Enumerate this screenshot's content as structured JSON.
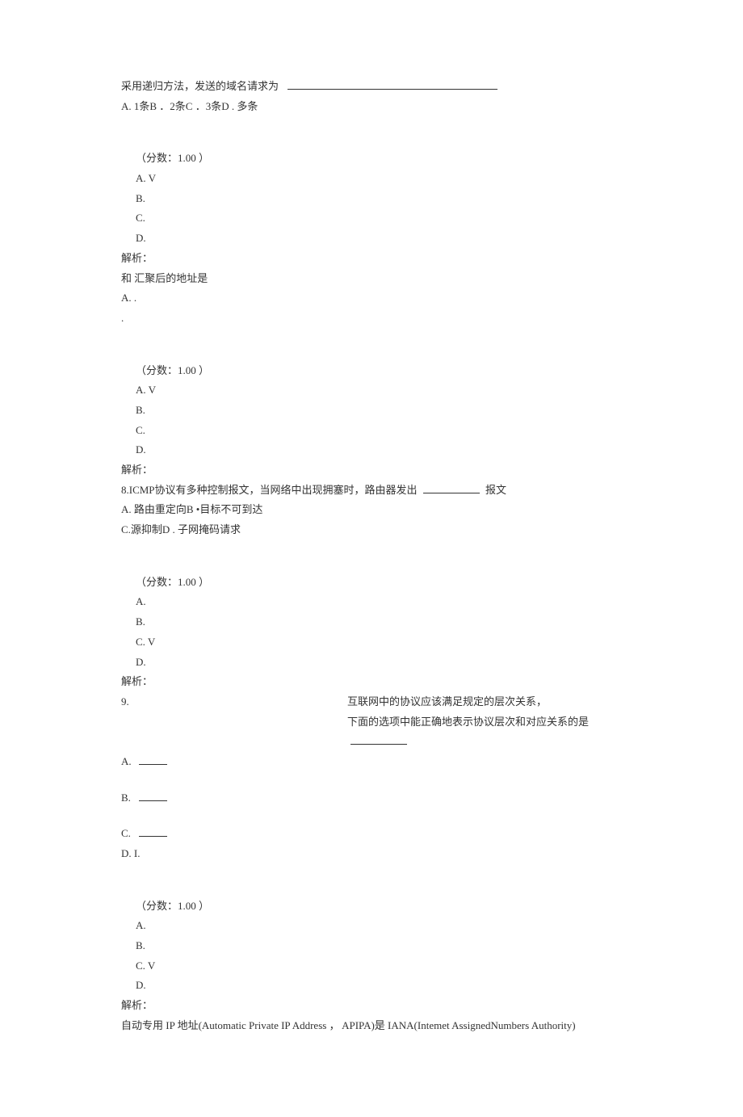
{
  "q6": {
    "stem": "采用递归方法，发送的域名请求为",
    "opts_line": "A.   1条B ．2条C ．3条D . 多条",
    "score": "（分数：1.00 ）",
    "A": "A.    V",
    "B": "B.",
    "C": "C.",
    "D": "D.",
    "jiexi": "解析："
  },
  "q7": {
    "stem": "和 汇聚后的地址是",
    "opt_a": "A.   .",
    "dot": ".",
    "score": "（分数：1.00 ）",
    "A": "A.    V",
    "B": "B.",
    "C": "C.",
    "D": "D.",
    "jiexi": "解析："
  },
  "q8": {
    "stem1": "8.ICMP协议有多种控制报文，当网络中出现拥塞时，路由器发出",
    "stem2": "报文",
    "line2": "A.       路由重定向B •目标不可到达",
    "line3": "C.源抑制D . 子网掩码请求",
    "score": "（分数：1.00 ）",
    "A": "A.",
    "B": "B.",
    "C": "C.    V",
    "D": "D.",
    "jiexi": "解析："
  },
  "q9": {
    "num": "9.",
    "right1": "互联网中的协议应该满足规定的层次关系，",
    "right2": "下面的选项中能正确地表示协议层次和对应关系的是",
    "A": "A.",
    "B": "B.",
    "C": "C.",
    "D": "D.   I.",
    "score": "（分数：1.00 ）",
    "sA": "A.",
    "sB": "B.",
    "sC": "C.    V",
    "sD": "D.",
    "jiexi": "解析："
  },
  "footer": "自动专用 IP 地址(Automatic Private IP Address ， APIPA)是  IANA(Intemet AssignedNumbers Authority)"
}
